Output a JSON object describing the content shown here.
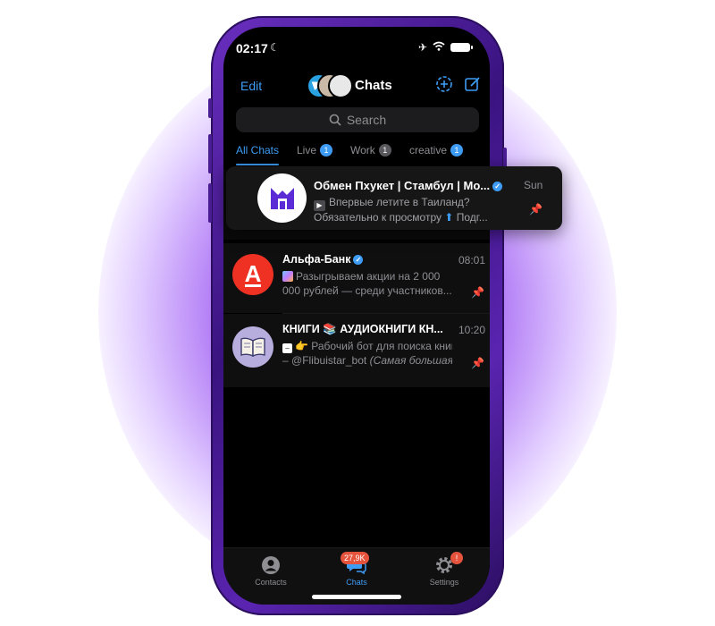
{
  "status_bar": {
    "time": "02:17",
    "moon": "☾",
    "airplane": "✈",
    "wifi": "◠"
  },
  "header": {
    "edit_label": "Edit",
    "title": "Chats"
  },
  "search": {
    "placeholder": "Search"
  },
  "folders": [
    {
      "label": "All Chats",
      "badge": ""
    },
    {
      "label": "Live",
      "badge": "1"
    },
    {
      "label": "Work",
      "badge": "1"
    },
    {
      "label": "creative",
      "badge": "1"
    }
  ],
  "chats": [
    {
      "name": "Обмен Пхукет | Стамбул | Мо...",
      "time": "Sun",
      "line1": "Впервые летите в Таиланд?",
      "line2_a": "Обязательно к просмотру",
      "line2_b": "Подг...",
      "verified": true,
      "pinned": true
    },
    {
      "name": "Альфа-Банк",
      "time": "08:01",
      "line1": "Разыгрываем акции на 2 000",
      "line2": "000 рублей — среди участников...",
      "avatar_letter": "А",
      "verified": true,
      "pinned": true
    },
    {
      "name": "КНИГИ 📚 АУДИОКНИГИ КН...",
      "time": "10:20",
      "line1": "👉 Рабочий бот для поиска книг",
      "line2_a": "– @Flibuistar_bot",
      "line2_b": "(Самая большая...",
      "pinned": true
    }
  ],
  "tabbar": {
    "items": [
      {
        "label": "Contacts",
        "badge": ""
      },
      {
        "label": "Chats",
        "badge": "27,9K"
      },
      {
        "label": "Settings",
        "badge": "!"
      }
    ]
  },
  "colors": {
    "accent": "#3e9cf5",
    "alfa_red": "#ef3124",
    "badge_red": "#e5533d",
    "glow": "#963cff"
  }
}
